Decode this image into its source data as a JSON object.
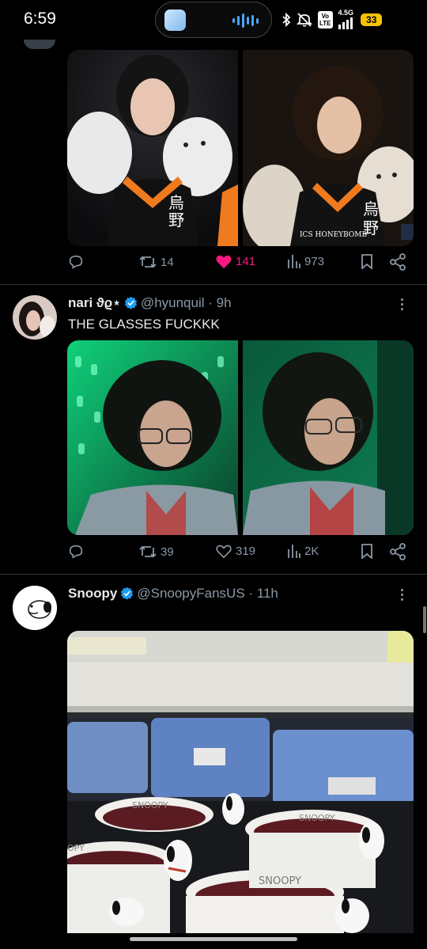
{
  "status_bar": {
    "time": "6:59",
    "icons": [
      "audio-wave-icon",
      "bluetooth-icon",
      "mute-icon",
      "volte-icon",
      "signal-icon"
    ],
    "volte_label": "Vo\nLTE",
    "network_label": "4.5G",
    "battery": "33"
  },
  "tweets": [
    {
      "id": "tweet-1",
      "images": [
        "photo-person-with-plush-toys-1",
        "photo-person-with-plush-toys-2"
      ],
      "image_overlay_text": "ICS HONEYBOMB",
      "reply_count": "",
      "retweet_count": "14",
      "like_count": "141",
      "liked": true,
      "view_count": "973"
    },
    {
      "id": "tweet-2",
      "display_name": "nari ϑϱ⋆",
      "verified": true,
      "handle": "@hyunquil",
      "time": "9h",
      "text": "THE GLASSES FUCKKK",
      "images": [
        "photo-person-with-glasses-green-1",
        "photo-person-with-glasses-green-2"
      ],
      "retweet_count": "39",
      "like_count": "319",
      "liked": false,
      "view_count": "2K"
    },
    {
      "id": "tweet-3",
      "display_name": "Snoopy",
      "verified": true,
      "handle": "@SnoopyFansUS",
      "time": "11h",
      "text": "",
      "images": [
        "photo-snoopy-mugs-on-shelf"
      ],
      "mug_text": "SNOOPY",
      "mug_text_2": "OPY"
    }
  ],
  "colors": {
    "background": "#000000",
    "text": "#e7e9ea",
    "muted": "#8b98a5",
    "like_active": "#f91880",
    "verified": "#1d9bf0",
    "divider": "#2f3336"
  }
}
